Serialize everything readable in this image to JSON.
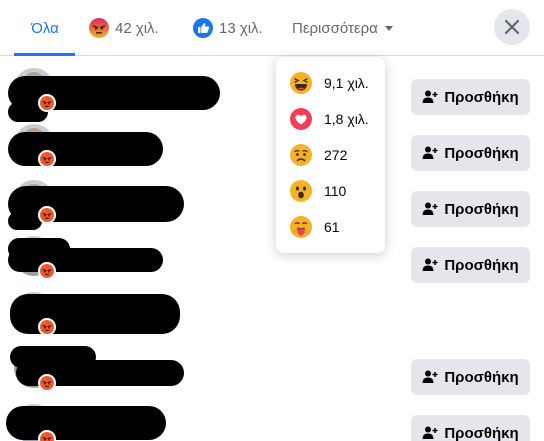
{
  "tabs": {
    "all_label": "Όλα",
    "angry_count": "42 χιλ.",
    "like_count": "13 χιλ.",
    "more_label": "Περισσότερα"
  },
  "dropdown": {
    "items": [
      {
        "reaction": "haha",
        "count": "9,1 χιλ."
      },
      {
        "reaction": "love",
        "count": "1,8 χιλ."
      },
      {
        "reaction": "sad",
        "count": "272"
      },
      {
        "reaction": "wow",
        "count": "110"
      },
      {
        "reaction": "care",
        "count": "61"
      }
    ]
  },
  "rows": [
    {
      "reaction": "angry",
      "button": "Προσθήκη"
    },
    {
      "reaction": "angry",
      "button": "Προσθήκη"
    },
    {
      "reaction": "angry",
      "button": "Προσθήκη"
    },
    {
      "reaction": "angry",
      "button": "Προσθήκη"
    },
    {
      "reaction": "angry",
      "button": null
    },
    {
      "reaction": "angry",
      "button": "Προσθήκη"
    },
    {
      "reaction": "angry",
      "button": "Προσθήκη"
    }
  ],
  "colors": {
    "accent": "#1877f2",
    "button_bg": "#e4e6eb",
    "angry": "#f0592f",
    "haha": "#f7b125",
    "love": "#f33e58"
  },
  "icons": {
    "close": "close-icon",
    "add_friend": "add-friend-icon",
    "caret": "caret-down-icon"
  }
}
